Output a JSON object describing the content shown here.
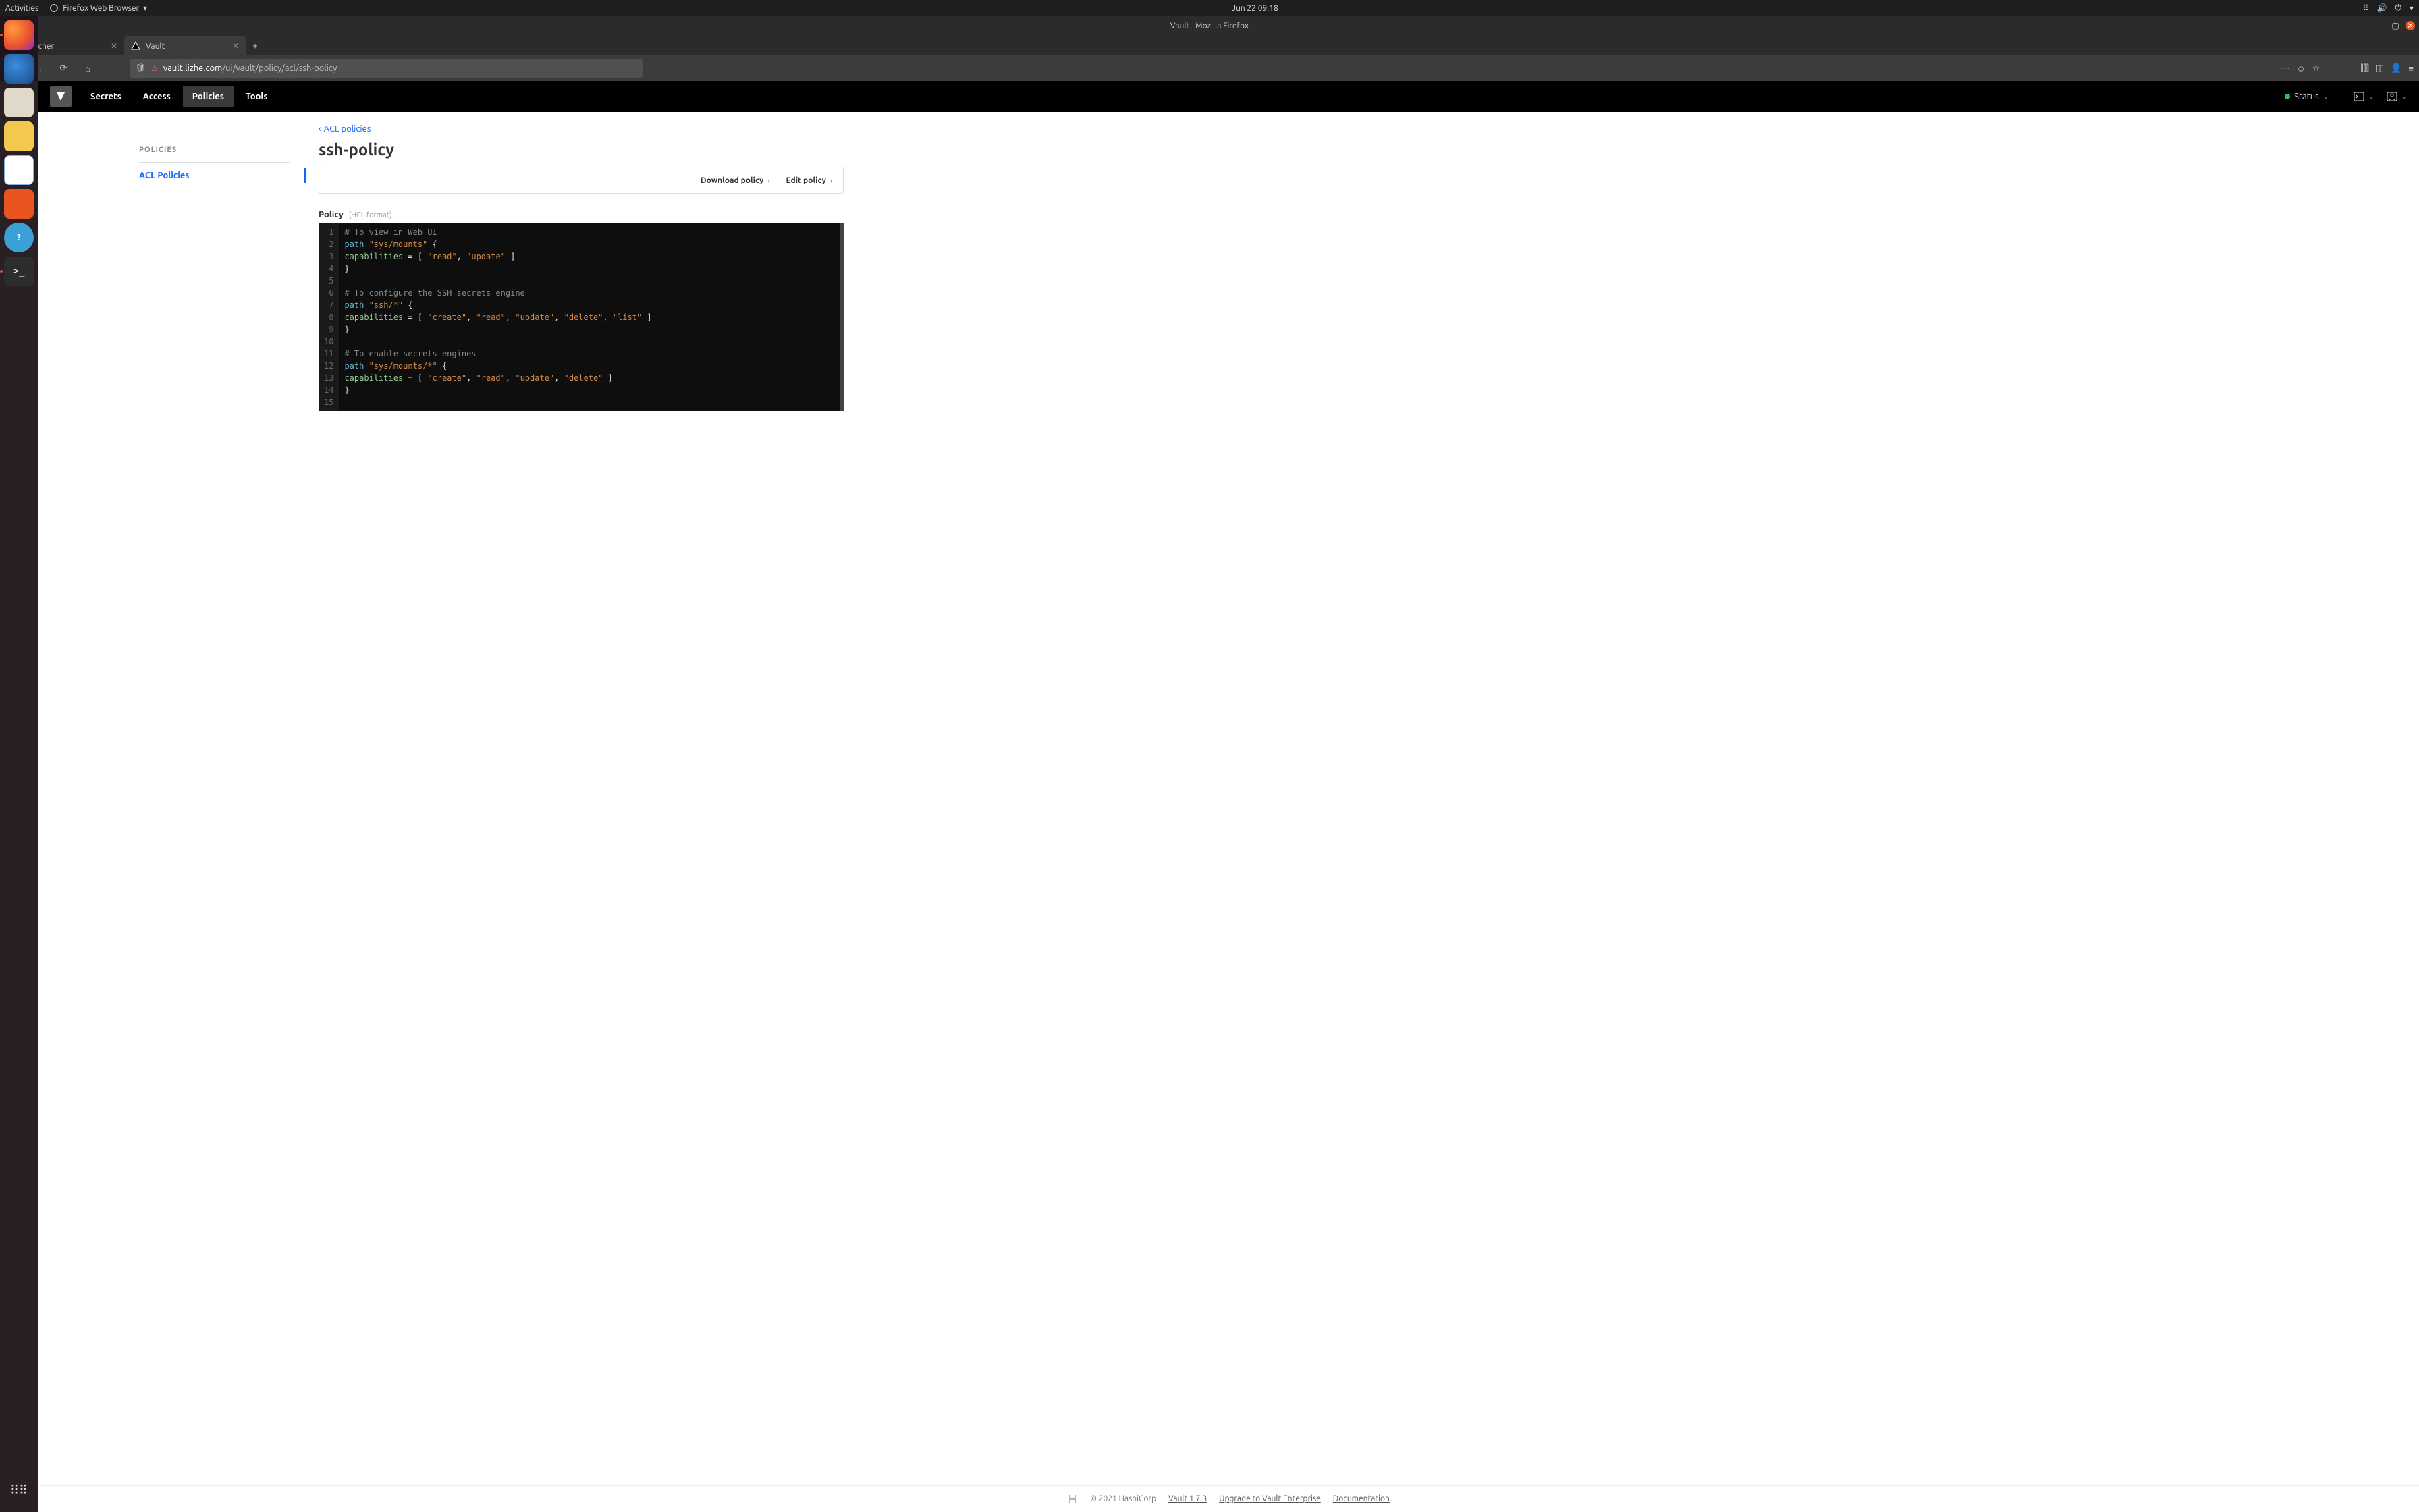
{
  "gnome": {
    "activities": "Activities",
    "app": "Firefox Web Browser",
    "clock": "Jun 22  09:18"
  },
  "firefox": {
    "title": "Vault - Mozilla Firefox",
    "tabs": [
      {
        "label": "Rancher",
        "icon": "rancher"
      },
      {
        "label": "Vault",
        "icon": "vault"
      }
    ],
    "url_domain": "vault.lizhe.com",
    "url_path": "/ui/vault/policy/acl/ssh-policy"
  },
  "vault": {
    "nav": {
      "secrets": "Secrets",
      "access": "Access",
      "policies": "Policies",
      "tools": "Tools"
    },
    "status": "Status",
    "sidebar": {
      "title": "POLICIES",
      "items": [
        "ACL Policies"
      ]
    },
    "breadcrumb": "ACL policies",
    "page_title": "ssh-policy",
    "actions": {
      "download": "Download policy",
      "edit": "Edit policy"
    },
    "policy_label": "Policy",
    "hcl_format": "(HCL format)",
    "code": [
      {
        "n": 1,
        "tokens": [
          [
            "comment",
            "# To view in Web UI"
          ]
        ]
      },
      {
        "n": 2,
        "tokens": [
          [
            "keyword",
            "path "
          ],
          [
            "string",
            "\"sys/mounts\""
          ],
          [
            "op",
            " {"
          ]
        ]
      },
      {
        "n": 3,
        "tokens": [
          [
            "op",
            "  "
          ],
          [
            "ident",
            "capabilities"
          ],
          [
            "op",
            " = [ "
          ],
          [
            "string",
            "\"read\""
          ],
          [
            "op",
            ", "
          ],
          [
            "string",
            "\"update\""
          ],
          [
            "op",
            " ]"
          ]
        ]
      },
      {
        "n": 4,
        "tokens": [
          [
            "op",
            "}"
          ]
        ]
      },
      {
        "n": 5,
        "tokens": []
      },
      {
        "n": 6,
        "tokens": [
          [
            "comment",
            "# To configure the SSH secrets engine"
          ]
        ]
      },
      {
        "n": 7,
        "tokens": [
          [
            "keyword",
            "path "
          ],
          [
            "string",
            "\"ssh/*\""
          ],
          [
            "op",
            " {"
          ]
        ]
      },
      {
        "n": 8,
        "tokens": [
          [
            "op",
            "  "
          ],
          [
            "ident",
            "capabilities"
          ],
          [
            "op",
            " = [ "
          ],
          [
            "string",
            "\"create\""
          ],
          [
            "op",
            ", "
          ],
          [
            "string",
            "\"read\""
          ],
          [
            "op",
            ", "
          ],
          [
            "string",
            "\"update\""
          ],
          [
            "op",
            ", "
          ],
          [
            "string",
            "\"delete\""
          ],
          [
            "op",
            ", "
          ],
          [
            "string",
            "\"list\""
          ],
          [
            "op",
            " ]"
          ]
        ]
      },
      {
        "n": 9,
        "tokens": [
          [
            "op",
            "}"
          ]
        ]
      },
      {
        "n": 10,
        "tokens": []
      },
      {
        "n": 11,
        "tokens": [
          [
            "comment",
            "# To enable secrets engines"
          ]
        ]
      },
      {
        "n": 12,
        "tokens": [
          [
            "keyword",
            "path "
          ],
          [
            "string",
            "\"sys/mounts/*\""
          ],
          [
            "op",
            " {"
          ]
        ]
      },
      {
        "n": 13,
        "tokens": [
          [
            "op",
            "  "
          ],
          [
            "ident",
            "capabilities"
          ],
          [
            "op",
            " = [ "
          ],
          [
            "string",
            "\"create\""
          ],
          [
            "op",
            ", "
          ],
          [
            "string",
            "\"read\""
          ],
          [
            "op",
            ", "
          ],
          [
            "string",
            "\"update\""
          ],
          [
            "op",
            ", "
          ],
          [
            "string",
            "\"delete\""
          ],
          [
            "op",
            " ]"
          ]
        ]
      },
      {
        "n": 14,
        "tokens": [
          [
            "op",
            "}"
          ]
        ]
      },
      {
        "n": 15,
        "tokens": []
      }
    ]
  },
  "footer": {
    "copyright": "© 2021 HashiCorp",
    "version": "Vault 1.7.3",
    "upgrade": "Upgrade to Vault Enterprise",
    "docs": "Documentation"
  }
}
